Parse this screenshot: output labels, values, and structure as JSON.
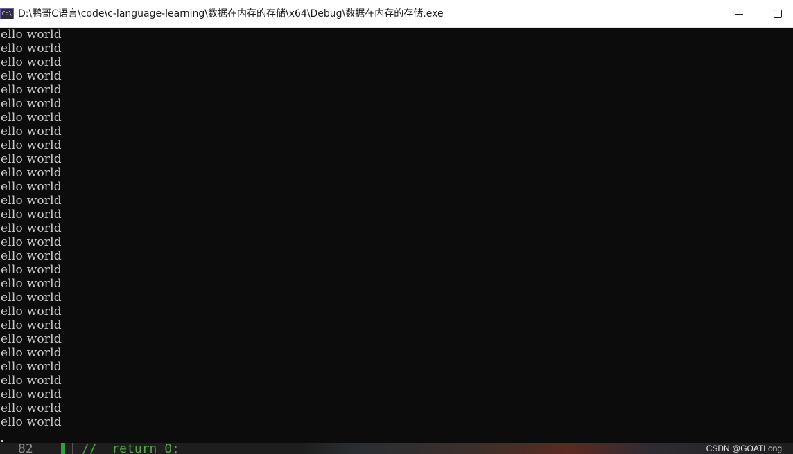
{
  "window": {
    "title": "D:\\鹏哥C语言\\code\\c-language-learning\\数据在内存的存储\\x64\\Debug\\数据在内存的存储.exe",
    "icon": "console-app-icon",
    "icon_text": "C:\\",
    "minimize_icon": "minimize-icon",
    "maximize_icon": "maximize-icon"
  },
  "console": {
    "lines": [
      "ello world",
      "ello world",
      "ello world",
      "ello world",
      "ello world",
      "ello world",
      "ello world",
      "ello world",
      "ello world",
      "ello world",
      "ello world",
      "ello world",
      "ello world",
      "ello world",
      "ello world",
      "ello world",
      "ello world",
      "ello world",
      "ello world",
      "ello world",
      "ello world",
      "ello world",
      "ello world",
      "ello world",
      "ello world",
      "ello world",
      "ello world",
      "ello world",
      "ello world"
    ],
    "text_color": "#cccccc",
    "background": "#0c0c0c"
  },
  "editor": {
    "line_number": "82",
    "code": "//  return 0;"
  },
  "watermark": "CSDN @GOATLong"
}
